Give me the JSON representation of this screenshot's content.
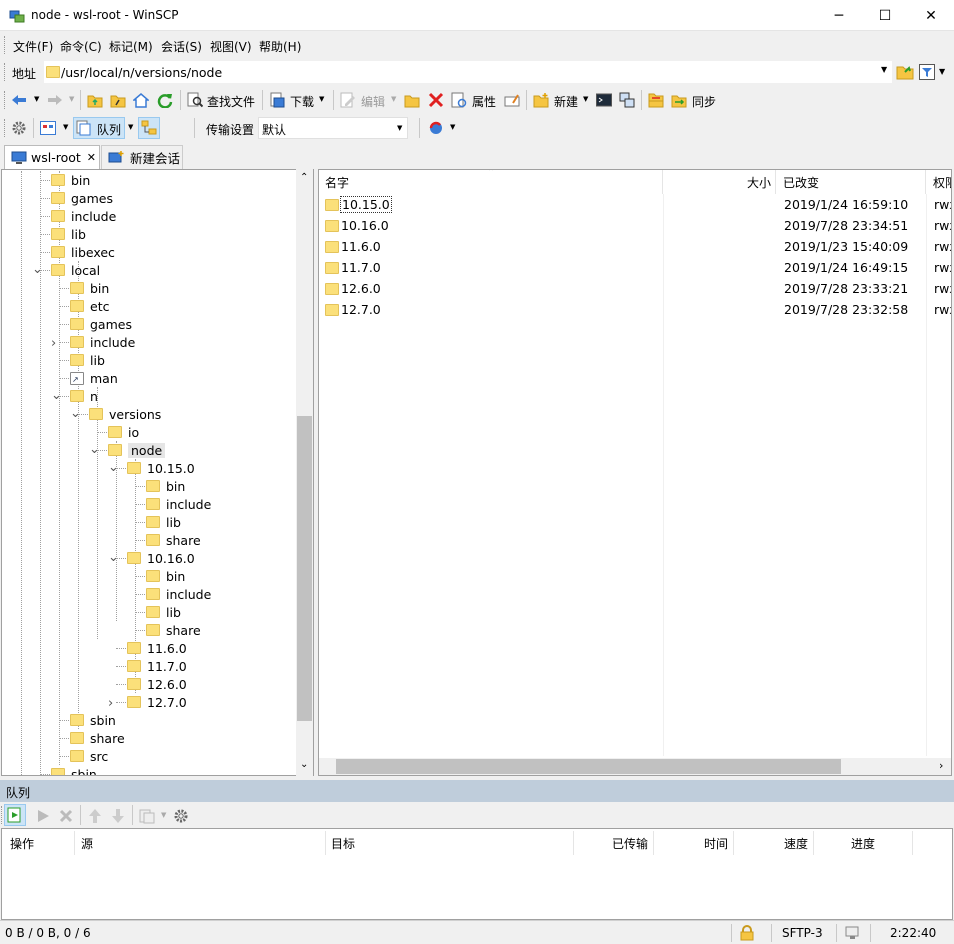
{
  "window": {
    "title": "node - wsl-root - WinSCP",
    "minimize": "─",
    "maximize": "☐",
    "close": "✕"
  },
  "menu": [
    "文件(F)",
    "命令(C)",
    "标记(M)",
    "会话(S)",
    "视图(V)",
    "帮助(H)"
  ],
  "address": {
    "label": "地址",
    "value": "/usr/local/n/versions/node"
  },
  "toolbar1": {
    "find": "查找文件",
    "download": "下载",
    "edit": "编辑",
    "properties": "属性",
    "new": "新建",
    "sync": "同步"
  },
  "toolbar2": {
    "queue": "队列",
    "transfer_label": "传输设置",
    "transfer_value": "默认"
  },
  "tabs": [
    {
      "label": "wsl-root",
      "close": "✕"
    },
    {
      "label": "新建会话"
    }
  ],
  "tree": {
    "items": [
      {
        "label": "bin"
      },
      {
        "label": "games"
      },
      {
        "label": "include"
      },
      {
        "label": "lib"
      },
      {
        "label": "libexec"
      },
      {
        "label": "local",
        "expanded": true
      },
      {
        "label": "bin"
      },
      {
        "label": "etc"
      },
      {
        "label": "games"
      },
      {
        "label": "include",
        "collapsed": true
      },
      {
        "label": "lib"
      },
      {
        "label": "man",
        "link": true
      },
      {
        "label": "n",
        "expanded": true
      },
      {
        "label": "versions",
        "expanded": true
      },
      {
        "label": "io"
      },
      {
        "label": "node",
        "expanded": true,
        "selected": true
      },
      {
        "label": "10.15.0",
        "expanded": true
      },
      {
        "label": "bin"
      },
      {
        "label": "include"
      },
      {
        "label": "lib"
      },
      {
        "label": "share"
      },
      {
        "label": "10.16.0",
        "expanded": true
      },
      {
        "label": "bin"
      },
      {
        "label": "include"
      },
      {
        "label": "lib"
      },
      {
        "label": "share"
      },
      {
        "label": "11.6.0"
      },
      {
        "label": "11.7.0"
      },
      {
        "label": "12.6.0"
      },
      {
        "label": "12.7.0",
        "collapsed": true
      },
      {
        "label": "sbin"
      },
      {
        "label": "share"
      },
      {
        "label": "src"
      },
      {
        "label": "sbin"
      }
    ]
  },
  "files": {
    "columns": {
      "name": "名字",
      "size": "大小",
      "modified": "已改变",
      "perms": "权限"
    },
    "rows": [
      {
        "name": "10.15.0",
        "modified": "2019/1/24 16:59:10",
        "perms": "rwx"
      },
      {
        "name": "10.16.0",
        "modified": "2019/7/28 23:34:51",
        "perms": "rwx"
      },
      {
        "name": "11.6.0",
        "modified": "2019/1/23 15:40:09",
        "perms": "rwx"
      },
      {
        "name": "11.7.0",
        "modified": "2019/1/24 16:49:15",
        "perms": "rwx"
      },
      {
        "name": "12.6.0",
        "modified": "2019/7/28 23:33:21",
        "perms": "rwx"
      },
      {
        "name": "12.7.0",
        "modified": "2019/7/28 23:32:58",
        "perms": "rwx"
      }
    ]
  },
  "queue": {
    "title": "队列",
    "columns": {
      "op": "操作",
      "source": "源",
      "target": "目标",
      "transferred": "已传输",
      "time": "时间",
      "speed": "速度",
      "progress": "进度"
    }
  },
  "status": {
    "bytes": "0 B / 0 B,  0 / 6",
    "protocol": "SFTP-3",
    "time": "2:22:40"
  },
  "colors": {
    "folder": "#fbe07a",
    "selection": "#e5f3ff",
    "queue_bar": "#bfcddb",
    "accent": "#0078d7"
  }
}
